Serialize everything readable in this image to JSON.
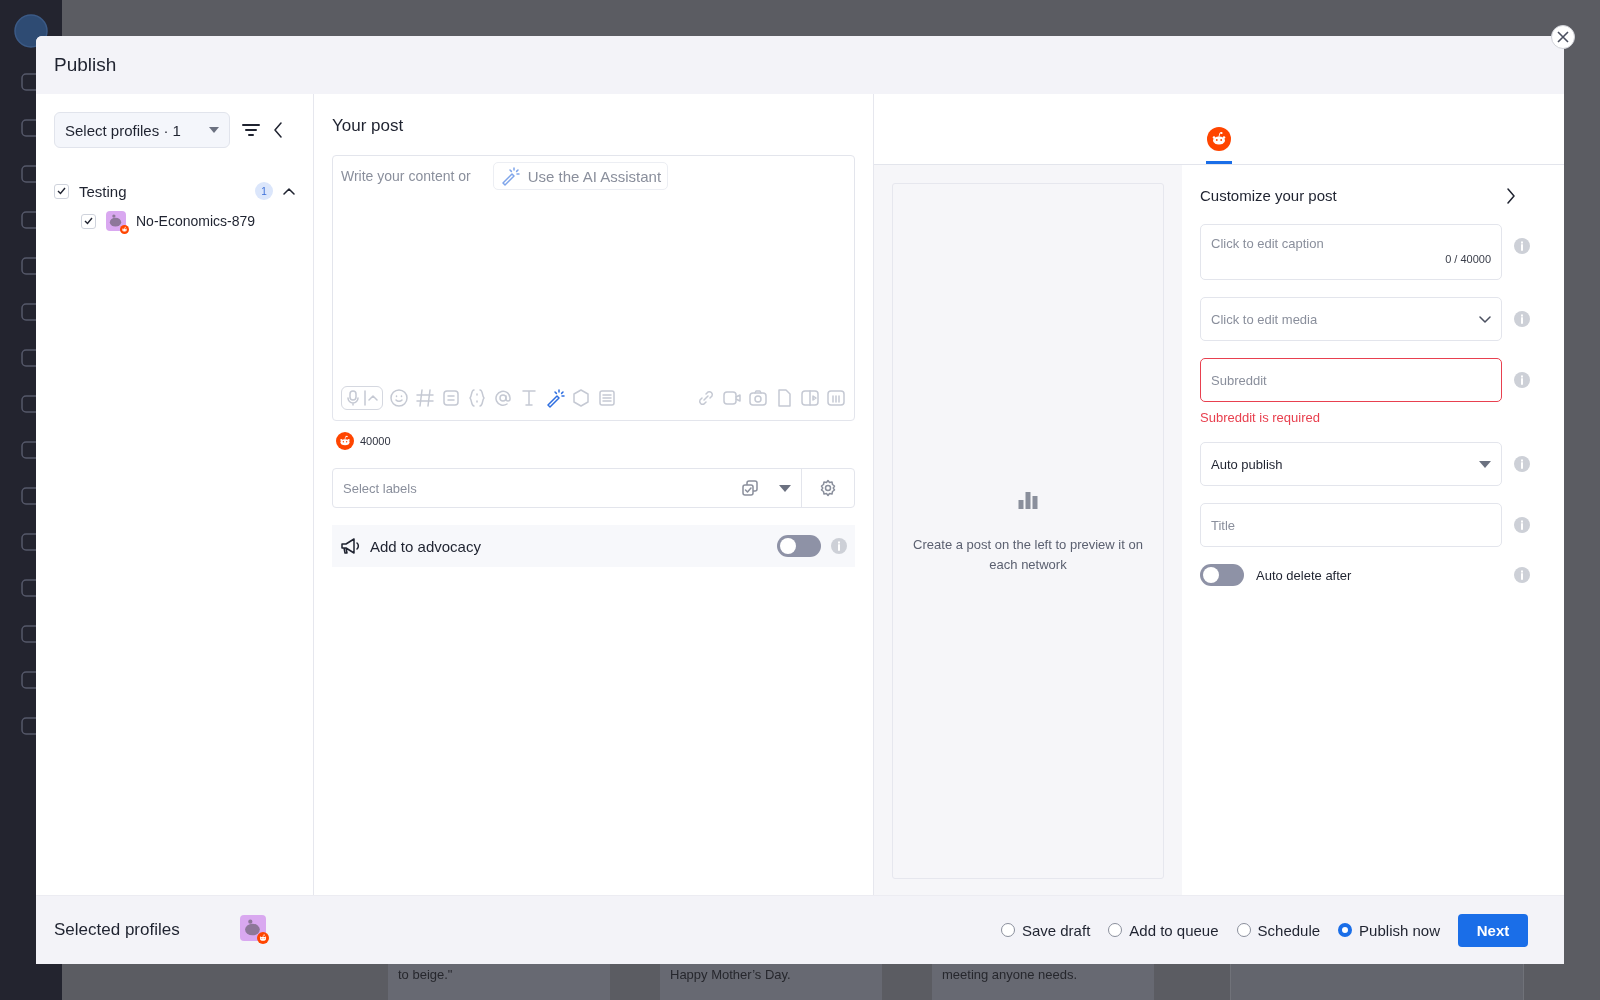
{
  "background": {
    "cards": [
      {
        "text": "to beige.\""
      },
      {
        "text": "Happy Mother’s Day."
      },
      {
        "text": "meeting anyone needs."
      }
    ]
  },
  "dialog": {
    "title": "Publish"
  },
  "profiles_panel": {
    "select": "Select profiles · 1",
    "groups": [
      {
        "name": "Testing",
        "checked": true,
        "count": "1",
        "expanded": true,
        "children": [
          {
            "name": "No-Economics-879",
            "checked": true
          }
        ]
      }
    ]
  },
  "post": {
    "heading": "Your post",
    "placeholder": "Write your content or",
    "ai_button": "Use the AI Assistant",
    "char_count": "40000",
    "labels_placeholder": "Select labels",
    "advocacy": {
      "label": "Add to advocacy",
      "on": false
    }
  },
  "preview": {
    "tabs": [
      {
        "kind": "reddit",
        "selected": true
      }
    ],
    "empty_text": "Create a post on the left to preview it on each network"
  },
  "customize": {
    "heading": "Customize your post",
    "fields": [
      {
        "kind": "textarea",
        "placeholder": "Click to edit caption",
        "counter": "0 / 40000"
      },
      {
        "kind": "dropdown",
        "placeholder": "Click to edit media"
      },
      {
        "kind": "text",
        "placeholder": "Subreddit",
        "error": "Subreddit is required"
      },
      {
        "kind": "select",
        "value": "Auto publish"
      },
      {
        "kind": "text",
        "placeholder": "Title"
      },
      {
        "kind": "toggle",
        "label": "Auto delete after",
        "on": false
      }
    ]
  },
  "footer": {
    "label": "Selected profiles",
    "options": [
      {
        "label": "Save draft",
        "selected": false
      },
      {
        "label": "Add to queue",
        "selected": false
      },
      {
        "label": "Schedule",
        "selected": false
      },
      {
        "label": "Publish now",
        "selected": true
      }
    ],
    "next": "Next"
  }
}
